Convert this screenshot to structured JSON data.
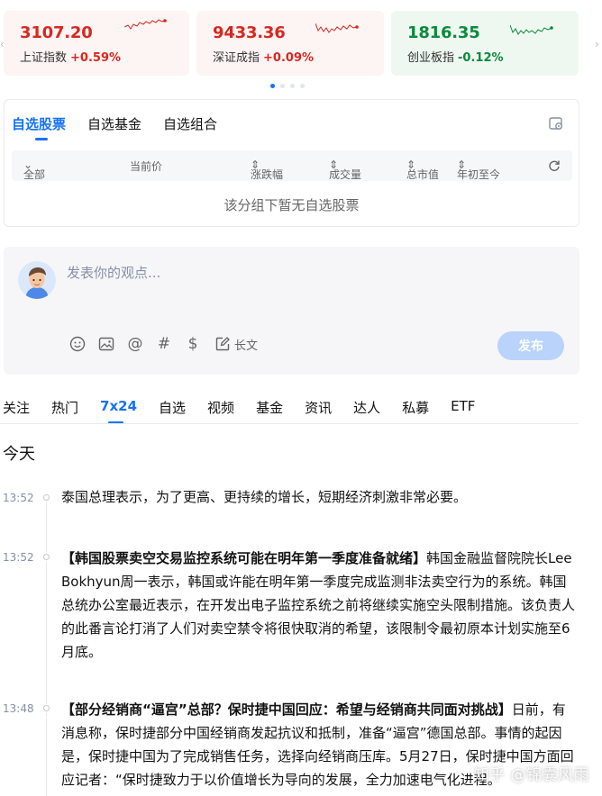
{
  "indices": [
    {
      "value": "3107.20",
      "name": "上证指数",
      "change": "+0.59%",
      "dir": "up"
    },
    {
      "value": "9433.36",
      "name": "深证成指",
      "change": "+0.09%",
      "dir": "up"
    },
    {
      "value": "1816.35",
      "name": "创业板指",
      "change": "-0.12%",
      "dir": "down"
    }
  ],
  "colors": {
    "accent": "#1772f6",
    "up": "#d6281f",
    "down": "#0c8a3c"
  },
  "watchlist": {
    "tabs": [
      "自选股票",
      "自选基金",
      "自选组合"
    ],
    "columns": {
      "all": "全部",
      "price": "当前价",
      "change": "涨跌幅",
      "volume": "成交量",
      "mcap": "总市值",
      "ytd": "年初至今"
    },
    "empty": "该分组下暂无自选股票"
  },
  "composer": {
    "placeholder": "发表你的观点...",
    "long_label": "长文",
    "publish": "发布",
    "tools": [
      "emoji-icon",
      "image-icon",
      "at-icon",
      "hashtag-icon",
      "dollar-icon"
    ]
  },
  "feed_tabs": [
    "关注",
    "热门",
    "7x24",
    "自选",
    "视频",
    "基金",
    "资讯",
    "达人",
    "私募",
    "ETF"
  ],
  "today": "今天",
  "items": [
    {
      "time": "13:52",
      "title": "",
      "body": "泰国总理表示，为了更高、更持续的增长，短期经济刺激非常必要。"
    },
    {
      "time": "13:52",
      "title": "【韩国股票卖空交易监控系统可能在明年第一季度准备就绪】",
      "body": "韩国金融监督院院长Lee Bokhyun周一表示，韩国或许能在明年第一季度完成监测非法卖空行为的系统。韩国总统办公室最近表示，在开发出电子监控系统之前将继续实施空头限制措施。该负责人的此番言论打消了人们对卖空禁令将很快取消的希望，该限制令最初原本计划实施至6月底。"
    },
    {
      "time": "13:48",
      "title": "【部分经销商“逼宫”总部？保时捷中国回应：希望与经销商共同面对挑战】",
      "body": "日前，有消息称，保时捷部分中国经销商发起抗议和抵制，准备“逼宫”德国总部。事情的起因是，保时捷中国为了完成销售任务，选择向经销商压库。5月27日，保时捷中国方面回应记者：“保时捷致力于以价值增长为导向的发展，全力加速电气化进程。"
    }
  ],
  "watermark": "知乎 @锦囊风雨"
}
